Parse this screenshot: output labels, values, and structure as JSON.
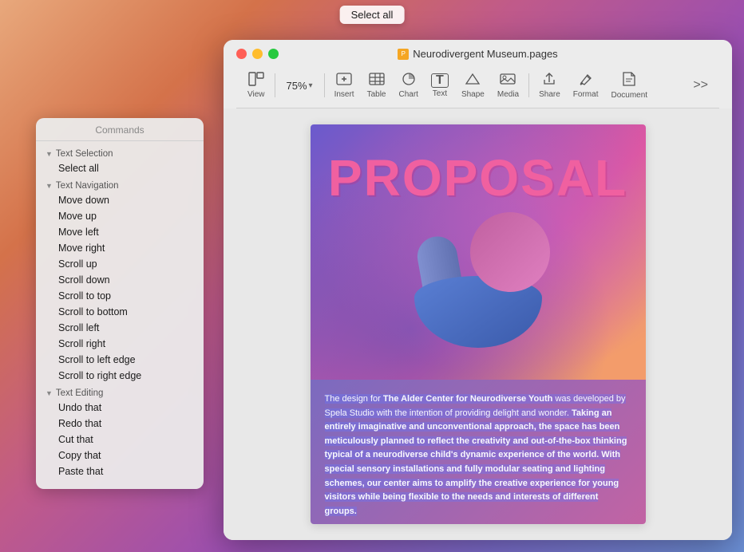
{
  "select_all_button": {
    "label": "Select all"
  },
  "commands_panel": {
    "title": "Commands",
    "sections": [
      {
        "id": "text-selection",
        "header": "Text Selection",
        "items": [
          "Select all"
        ]
      },
      {
        "id": "text-navigation",
        "header": "Text Navigation",
        "items": [
          "Move down",
          "Move up",
          "Move left",
          "Move right",
          "Scroll up",
          "Scroll down",
          "Scroll to top",
          "Scroll to bottom",
          "Scroll left",
          "Scroll right",
          "Scroll to left edge",
          "Scroll to right edge"
        ]
      },
      {
        "id": "text-editing",
        "header": "Text Editing",
        "items": [
          "Undo that",
          "Redo that",
          "Cut that",
          "Copy that",
          "Paste that"
        ]
      }
    ]
  },
  "window": {
    "title": "Neurodivergent Museum.pages",
    "controls": {
      "close": "●",
      "minimize": "●",
      "maximize": "●"
    }
  },
  "toolbar": {
    "zoom": "75%",
    "items": [
      {
        "id": "view",
        "icon": "⊞",
        "label": "View"
      },
      {
        "id": "zoom",
        "icon": "",
        "label": ""
      },
      {
        "id": "insert",
        "icon": "⊕",
        "label": "Insert"
      },
      {
        "id": "table",
        "icon": "⊞",
        "label": "Table"
      },
      {
        "id": "chart",
        "icon": "◔",
        "label": "Chart"
      },
      {
        "id": "text",
        "icon": "T",
        "label": "Text"
      },
      {
        "id": "shape",
        "icon": "⬟",
        "label": "Shape"
      },
      {
        "id": "media",
        "icon": "⊡",
        "label": "Media"
      },
      {
        "id": "share",
        "icon": "⬆",
        "label": "Share"
      },
      {
        "id": "format",
        "icon": "✏",
        "label": "Format"
      },
      {
        "id": "document",
        "icon": "📄",
        "label": "Document"
      }
    ]
  },
  "page": {
    "proposal_title": "PROPOSAL",
    "body_text": "The design for The Alder Center for Neurodiverse Youth was developed by Spela Studio with the intention of providing delight and wonder. Taking an entirely imaginative and unconventional approach, the space has been meticulously planned to reflect the creativity and out-of-the-box thinking typical of a neurodiverse child's dynamic experience of the world. With special sensory installations and fully modular seating and lighting schemes, our center aims to amplify the creative experience for young visitors while being flexible to the needs and interests of different groups."
  }
}
